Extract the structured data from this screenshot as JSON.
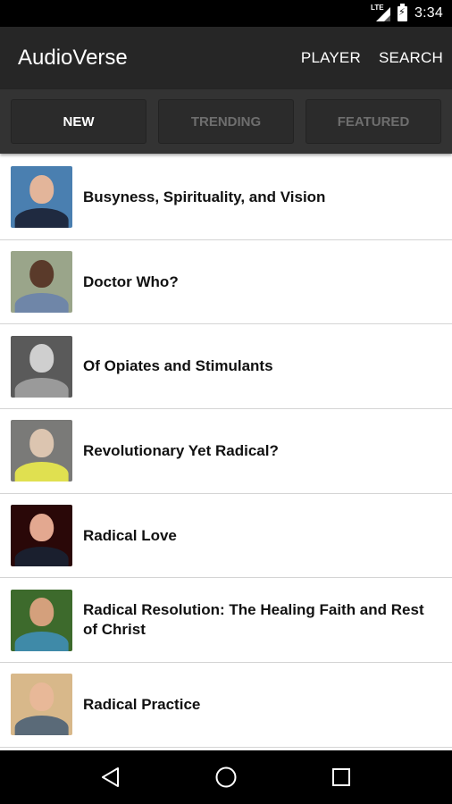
{
  "status_bar": {
    "network": "LTE",
    "time": "3:34"
  },
  "app_bar": {
    "title": "AudioVerse",
    "actions": [
      "PLAYER",
      "SEARCH"
    ]
  },
  "tabs": [
    {
      "label": "NEW",
      "active": true
    },
    {
      "label": "TRENDING",
      "active": false
    },
    {
      "label": "FEATURED",
      "active": false
    }
  ],
  "list": {
    "items": [
      {
        "title": "Busyness, Spirituality, and Vision",
        "thumb_icon": "speaker-photo",
        "thumb_bg": "#4a7fb0",
        "head": "#e3b59a",
        "body": "#1f2a40"
      },
      {
        "title": "Doctor Who?",
        "thumb_icon": "speaker-photo",
        "thumb_bg": "#9aa58a",
        "head": "#5a3a2a",
        "body": "#6f86a8"
      },
      {
        "title": "Of Opiates and Stimulants",
        "thumb_icon": "speaker-photo",
        "thumb_bg": "#5a5a5a",
        "head": "#cfcfcf",
        "body": "#9a9a9a"
      },
      {
        "title": "Revolutionary Yet Radical?",
        "thumb_icon": "speaker-photo",
        "thumb_bg": "#7a7a78",
        "head": "#dcc5b0",
        "body": "#e0e050"
      },
      {
        "title": "Radical Love",
        "thumb_icon": "speaker-photo",
        "thumb_bg": "#2a0808",
        "head": "#e3a890",
        "body": "#1a1f2e"
      },
      {
        "title": "Radical Resolution: The Healing Faith and Rest of Christ",
        "thumb_icon": "speaker-photo",
        "thumb_bg": "#3d6a2c",
        "head": "#d4a07c",
        "body": "#3f8aa8"
      },
      {
        "title": "Radical Practice",
        "thumb_icon": "speaker-photo",
        "thumb_bg": "#d8b88a",
        "head": "#e8b898",
        "body": "#5a6a78"
      }
    ]
  },
  "nav_bar": {
    "buttons": [
      "back-icon",
      "home-icon",
      "recents-icon"
    ]
  }
}
